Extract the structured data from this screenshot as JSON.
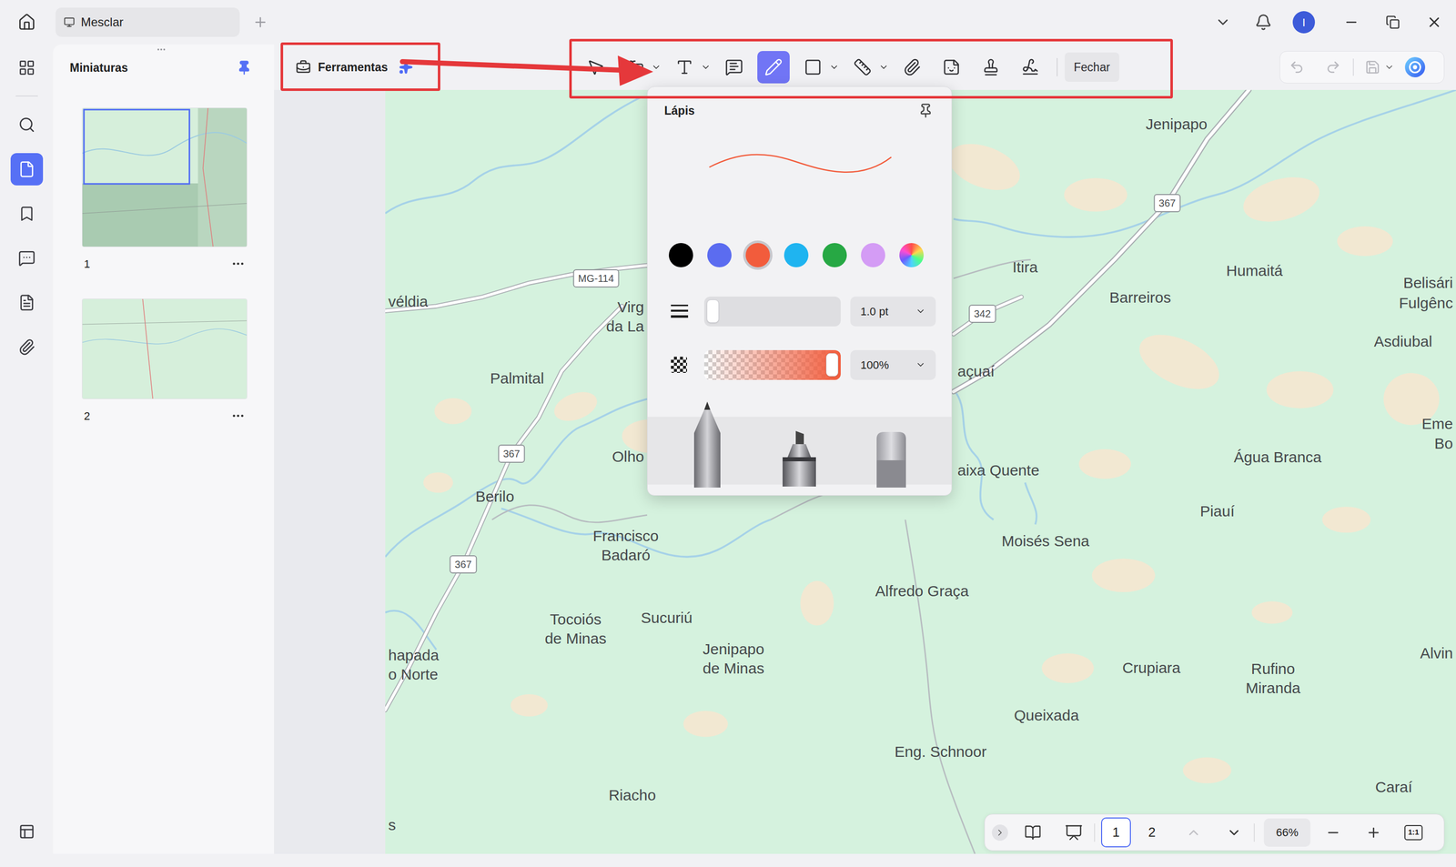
{
  "window": {
    "tab": "Mesclar",
    "avatar": "I"
  },
  "sidebar": {
    "items": [
      {
        "selected": false
      },
      {
        "selected": false
      },
      {
        "selected": true
      },
      {
        "selected": false
      },
      {
        "selected": false
      },
      {
        "selected": false
      },
      {
        "selected": false
      }
    ]
  },
  "thumbnails": {
    "title": "Miniaturas",
    "pages": [
      {
        "label": "1",
        "selected": true
      },
      {
        "label": "2",
        "selected": false
      }
    ]
  },
  "toolbar": {
    "tools_button": "Ferramentas",
    "tools": [
      {
        "selected": false
      },
      {
        "selected": false
      },
      {
        "selected": false
      },
      {
        "selected": false
      },
      {
        "selected": true
      },
      {
        "selected": false
      },
      {
        "selected": false
      },
      {
        "selected": false
      },
      {
        "selected": false
      },
      {
        "selected": false
      },
      {
        "selected": false
      }
    ],
    "close": "Fechar",
    "undo_disabled": true,
    "redo_disabled": true
  },
  "pencil_panel": {
    "title": "Lápis",
    "colors": [
      {
        "kind": "swatch",
        "color": "#000000",
        "selected": false
      },
      {
        "kind": "swatch",
        "color": "#5b6cf0",
        "selected": false
      },
      {
        "kind": "swatch",
        "color": "#f25c3c",
        "selected": true
      },
      {
        "kind": "swatch",
        "color": "#1fb4f0",
        "selected": false
      },
      {
        "kind": "swatch",
        "color": "#27a844",
        "selected": false
      },
      {
        "kind": "swatch",
        "color": "#d49cf5",
        "selected": false
      },
      {
        "kind": "picker",
        "color": "#8a5cf0",
        "selected": false
      }
    ],
    "thickness": {
      "level": 0.0,
      "value": "1.0 pt"
    },
    "opacity": {
      "level": 1.0,
      "value": "100%"
    }
  },
  "map": {
    "labels": [
      "Jenipapo",
      "Itira",
      "Humaitá",
      "Barreiros",
      "Belisári",
      "Fulgênc",
      "Asdiubal",
      "Eme",
      "Bo",
      "Água Branca",
      "Piauí",
      "Moisés Sena",
      "aixa Quente",
      "açuaí",
      "Alfredo Graça",
      "Crupiara",
      "Rufino Miranda",
      "Alvin",
      "Queixada",
      "Eng. Schnoor",
      "Caraí",
      "Riacho",
      "Jenipapo de Minas",
      "Sucuriú",
      "Tocoiós de Minas",
      "Francisco Badaró",
      "Berilo",
      "Olho",
      "Palmital",
      "véldia",
      "Virg",
      "da La",
      "hapada",
      "o Norte",
      "s"
    ],
    "shields": [
      "MG-114",
      "367",
      "367",
      "367",
      "342"
    ]
  },
  "page_nav": {
    "pages": [
      {
        "label": "1",
        "selected": true
      },
      {
        "label": "2",
        "selected": false
      }
    ],
    "prev_disabled": true,
    "zoom": "66%",
    "actual_size": "1:1"
  }
}
